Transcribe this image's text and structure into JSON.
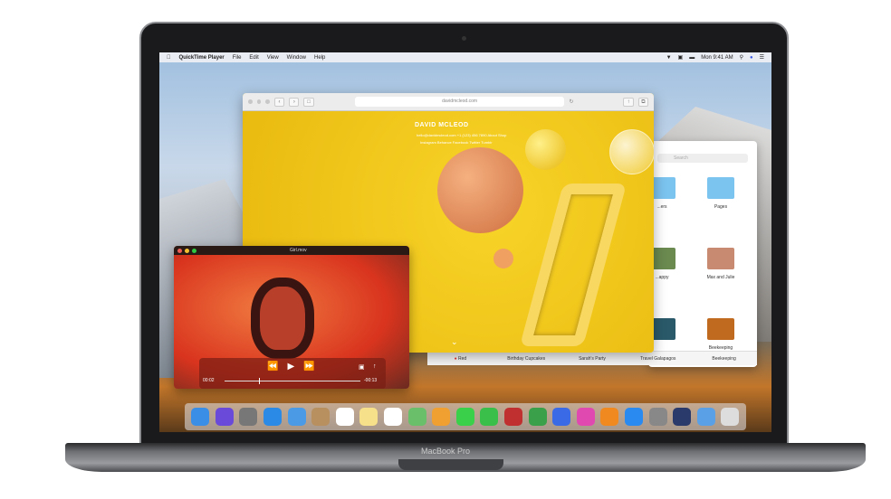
{
  "device": {
    "brand_label": "MacBook Pro"
  },
  "menubar": {
    "app": "QuickTime Player",
    "items": [
      "File",
      "Edit",
      "View",
      "Window",
      "Help"
    ],
    "clock": "Mon 9:41 AM"
  },
  "safari": {
    "url": "davidmcleod.com",
    "site_title": "DAVID MCLEOD",
    "contact_line": "hello@davidmcleod.com   +1 (123) 456 7890   About   Shop",
    "social_line": "Instagram   Behance   Facebook   Twitter   Tumblr"
  },
  "finder": {
    "search_placeholder": "Search",
    "items": [
      "...ers",
      "Pages",
      "...appy",
      "Max and Julie",
      "",
      "Beekeeping"
    ],
    "tags": [
      "Red",
      "Birthday Cupcakes",
      "Sarah's Party",
      "Travel Galapagos",
      "Beekeeping"
    ]
  },
  "quicktime": {
    "title": "Girl.mov",
    "elapsed": "00:02",
    "remaining": "-00:13",
    "progress": 0.25
  },
  "dock": {
    "icons": [
      "finder",
      "siri",
      "launchpad",
      "safari",
      "mail",
      "contacts",
      "calendar",
      "notes",
      "reminders",
      "maps",
      "photos",
      "messages",
      "facetime",
      "photo-booth",
      "numbers",
      "keynote",
      "itunes",
      "ibooks",
      "app-store",
      "system-preferences",
      "quicktime",
      "downloads",
      "trash"
    ],
    "colors": [
      "#3a8ee6",
      "#6a4ad8",
      "#777",
      "#2a8ae6",
      "#4a9ae6",
      "#b89060",
      "#fff",
      "#f6e08a",
      "#fff",
      "#6ac06a",
      "#f0a030",
      "#3ad04a",
      "#3ac04a",
      "#c03030",
      "#3aa04a",
      "#3a6ae6",
      "#e04ab0",
      "#f08a20",
      "#2a8af0",
      "#888",
      "#2a3a6a",
      "#5aa0e6",
      "#ddd"
    ]
  }
}
